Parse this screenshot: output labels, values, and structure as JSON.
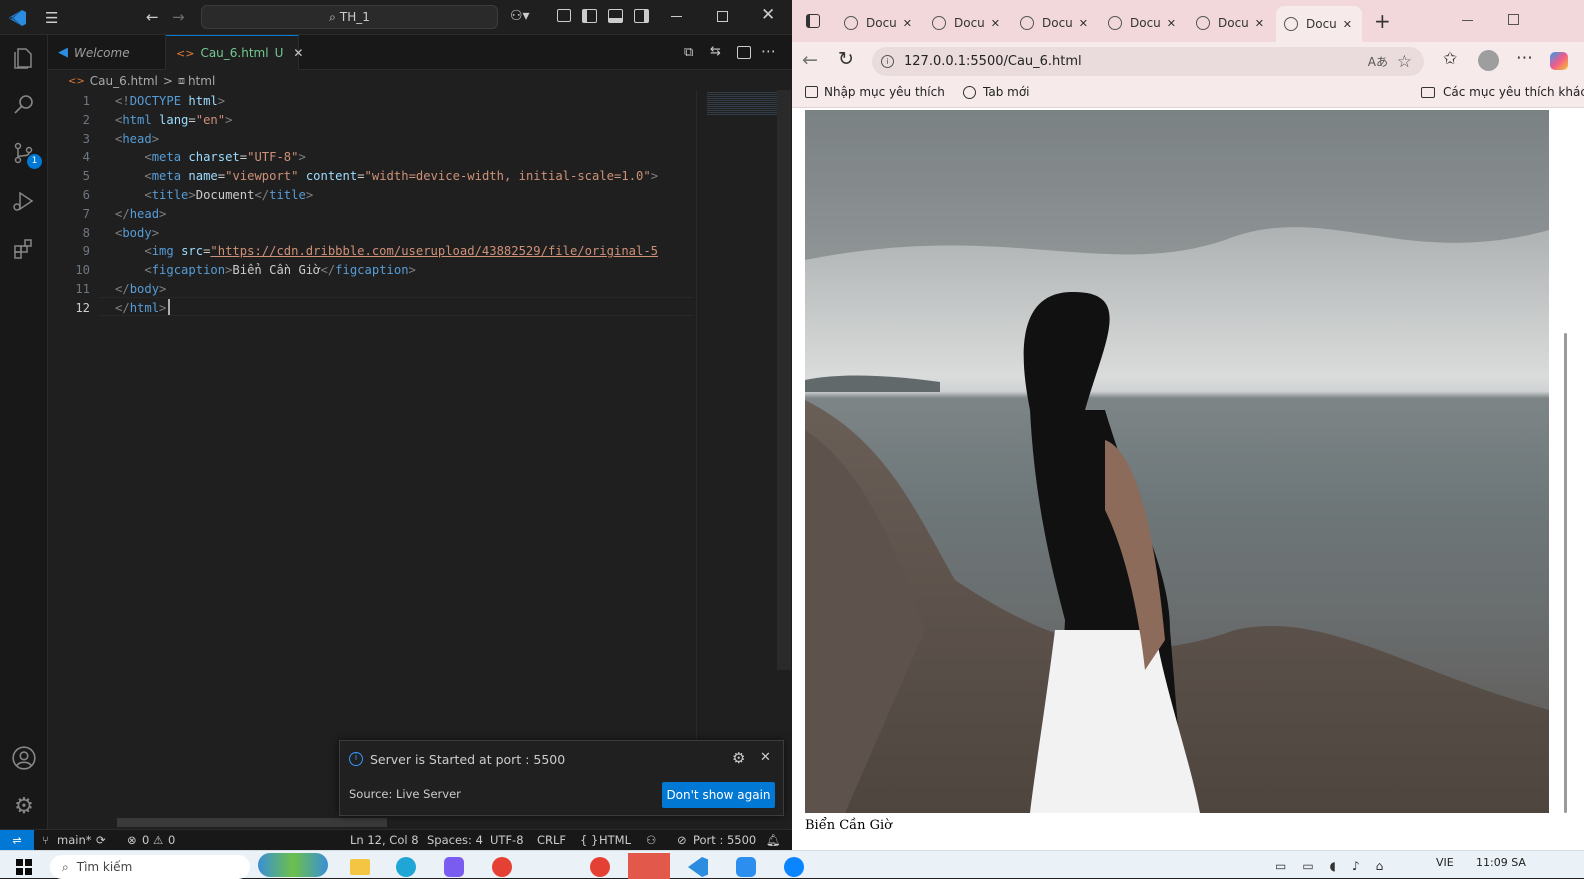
{
  "vscode": {
    "title": {
      "search_text": "TH_1"
    },
    "tabs": [
      {
        "label": "Welcome"
      },
      {
        "label": "Cau_6.html",
        "badge": "U"
      }
    ],
    "breadcrumb": {
      "file": "Cau_6.html",
      "separator": ">",
      "symbol": "html"
    },
    "activity_badge": "1",
    "code": {
      "line_numbers": [
        "1",
        "2",
        "3",
        "4",
        "5",
        "6",
        "7",
        "8",
        "9",
        "10",
        "11",
        "12"
      ],
      "lines": [
        [
          [
            "t",
            "<!"
          ],
          [
            "n",
            "DOCTYPE"
          ],
          [
            "x",
            " "
          ],
          [
            "a",
            "html"
          ],
          [
            "t",
            ">"
          ]
        ],
        [
          [
            "t",
            "<"
          ],
          [
            "n",
            "html"
          ],
          [
            "x",
            " "
          ],
          [
            "a",
            "lang"
          ],
          [
            "x",
            "="
          ],
          [
            "s",
            "\"en\""
          ],
          [
            "t",
            ">"
          ]
        ],
        [
          [
            "t",
            "<"
          ],
          [
            "n",
            "head"
          ],
          [
            "t",
            ">"
          ]
        ],
        [
          [
            "x",
            "    "
          ],
          [
            "t",
            "<"
          ],
          [
            "n",
            "meta"
          ],
          [
            "x",
            " "
          ],
          [
            "a",
            "charset"
          ],
          [
            "x",
            "="
          ],
          [
            "s",
            "\"UTF-8\""
          ],
          [
            "t",
            ">"
          ]
        ],
        [
          [
            "x",
            "    "
          ],
          [
            "t",
            "<"
          ],
          [
            "n",
            "meta"
          ],
          [
            "x",
            " "
          ],
          [
            "a",
            "name"
          ],
          [
            "x",
            "="
          ],
          [
            "s",
            "\"viewport\""
          ],
          [
            "x",
            " "
          ],
          [
            "a",
            "content"
          ],
          [
            "x",
            "="
          ],
          [
            "s",
            "\"width=device-width, initial-scale=1.0\""
          ],
          [
            "t",
            ">"
          ]
        ],
        [
          [
            "x",
            "    "
          ],
          [
            "t",
            "<"
          ],
          [
            "n",
            "title"
          ],
          [
            "t",
            ">"
          ],
          [
            "x",
            "Document"
          ],
          [
            "t",
            "</"
          ],
          [
            "n",
            "title"
          ],
          [
            "t",
            ">"
          ]
        ],
        [
          [
            "t",
            "</"
          ],
          [
            "n",
            "head"
          ],
          [
            "t",
            ">"
          ]
        ],
        [
          [
            "t",
            "<"
          ],
          [
            "n",
            "body"
          ],
          [
            "t",
            ">"
          ]
        ],
        [
          [
            "x",
            "    "
          ],
          [
            "t",
            "<"
          ],
          [
            "n",
            "img"
          ],
          [
            "x",
            " "
          ],
          [
            "a",
            "src"
          ],
          [
            "x",
            "="
          ],
          [
            "s",
            "\"https://cdn.dribbble.com/userupload/43882529/file/original-5"
          ]
        ],
        [
          [
            "x",
            "    "
          ],
          [
            "t",
            "<"
          ],
          [
            "n",
            "figcaption"
          ],
          [
            "t",
            ">"
          ],
          [
            "x",
            "Biển Cần Giờ"
          ],
          [
            "t",
            "</"
          ],
          [
            "n",
            "figcaption"
          ],
          [
            "t",
            ">"
          ]
        ],
        [
          [
            "t",
            "</"
          ],
          [
            "n",
            "body"
          ],
          [
            "t",
            ">"
          ]
        ],
        [
          [
            "t",
            "</"
          ],
          [
            "n",
            "html"
          ],
          [
            "t",
            ">"
          ]
        ]
      ]
    },
    "notification": {
      "message": "Server is Started at port : 5500",
      "source": "Source: Live Server",
      "button": "Don't show again"
    },
    "status": {
      "branch": "main*",
      "errors": "0",
      "warnings": "0",
      "position": "Ln 12, Col 8",
      "spaces": "Spaces: 4",
      "encoding": "UTF-8",
      "eol": "CRLF",
      "language": "HTML",
      "port": "Port : 5500"
    }
  },
  "browser": {
    "tabs": [
      {
        "label": "Docu"
      },
      {
        "label": "Docu"
      },
      {
        "label": "Docu"
      },
      {
        "label": "Docu"
      },
      {
        "label": "Docu"
      },
      {
        "label": "Docu",
        "active": true
      }
    ],
    "url": "127.0.0.1:5500/Cau_6.html",
    "favorites": [
      {
        "label": "Nhập mục yêu thích",
        "icon": "favorite-icon"
      },
      {
        "label": "Tab mới",
        "icon": "globe-icon"
      }
    ],
    "other_favorites": "Các mục yêu thích khác",
    "page": {
      "caption": "Biển Cần Giờ"
    }
  },
  "taskbar": {
    "search": "Tìm kiếm",
    "language": "VIE",
    "time": "11:09 SA"
  },
  "colors": {
    "accent": "#0078d4",
    "vscode_bg": "#1f1f1f",
    "browser_frame": "#f2d8da"
  }
}
